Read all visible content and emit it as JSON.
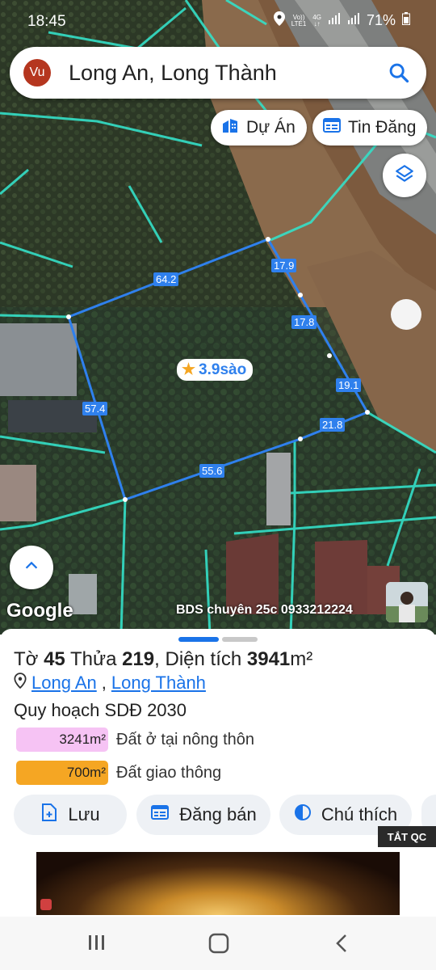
{
  "status": {
    "time": "18:45",
    "battery": "71%",
    "volte_top": "Vo))",
    "volte_bottom": "LTE1",
    "network_type": "4G"
  },
  "search": {
    "avatar_text": "Vu",
    "query": "Long An, Long Thành"
  },
  "map_chips": {
    "du_an": "Dự Án",
    "tin_dang": "Tin Đăng"
  },
  "plot": {
    "dimensions": [
      "64.2",
      "17.9",
      "17.8",
      "19.1",
      "21.8",
      "55.6",
      "57.4"
    ],
    "area_label": "3.9sào"
  },
  "map_footer": {
    "google": "Google",
    "credit": "BDS chuyên 25c 0933212224"
  },
  "sheet": {
    "title_prefix": "Tờ ",
    "to": "45",
    "thua_label": " Thửa ",
    "thua": "219",
    "dien_tich_label": ", Diện tích ",
    "area": "3941",
    "unit": "m²",
    "province": "Long An",
    "district": "Long Thành",
    "plan_title": "Quy hoạch SDĐ 2030",
    "land_uses": [
      {
        "area": "3241m²",
        "label": "Đất ở tại nông thôn",
        "color": "#f6c3f4"
      },
      {
        "area": "700m²",
        "label": "Đất giao thông",
        "color": "#f5a623"
      }
    ],
    "actions": {
      "save": "Lưu",
      "post": "Đăng bán",
      "legend": "Chú thích"
    }
  },
  "ad": {
    "close_label": "TẮT QC"
  }
}
